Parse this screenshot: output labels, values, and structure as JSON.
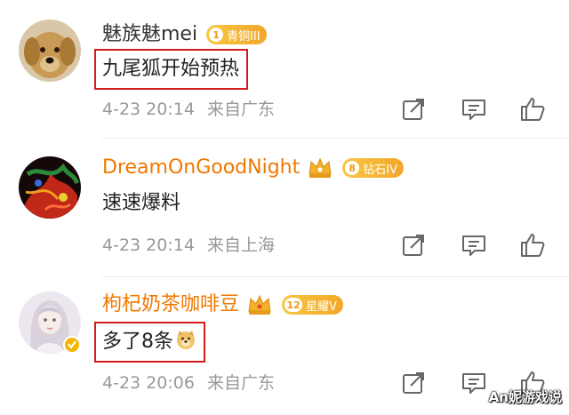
{
  "comments": [
    {
      "username": "魅族魅mei",
      "badge_level": "1",
      "badge_text": "青铜III",
      "content": "九尾狐开始预热",
      "time": "4-23 20:14",
      "location": "来自广东"
    },
    {
      "username": "DreamOnGoodNight",
      "badge_level": "8",
      "badge_text": "钻石IV",
      "content": "速速爆料",
      "time": "4-23 20:14",
      "location": "来自上海"
    },
    {
      "username": "枸杞奶茶咖啡豆",
      "badge_level": "12",
      "badge_text": "星耀V",
      "content": "多了8条",
      "time": "4-23 20:06",
      "location": "来自广东"
    }
  ],
  "watermark": "An妮游戏说",
  "colors": {
    "highlight_border": "#d41a1a",
    "vip_name": "#f07800",
    "badge": "#f3a72a",
    "meta_text": "#999999"
  },
  "icons": [
    "share-icon",
    "comment-icon",
    "like-icon",
    "crown-icon",
    "verified-icon",
    "doge-emoji-icon"
  ]
}
